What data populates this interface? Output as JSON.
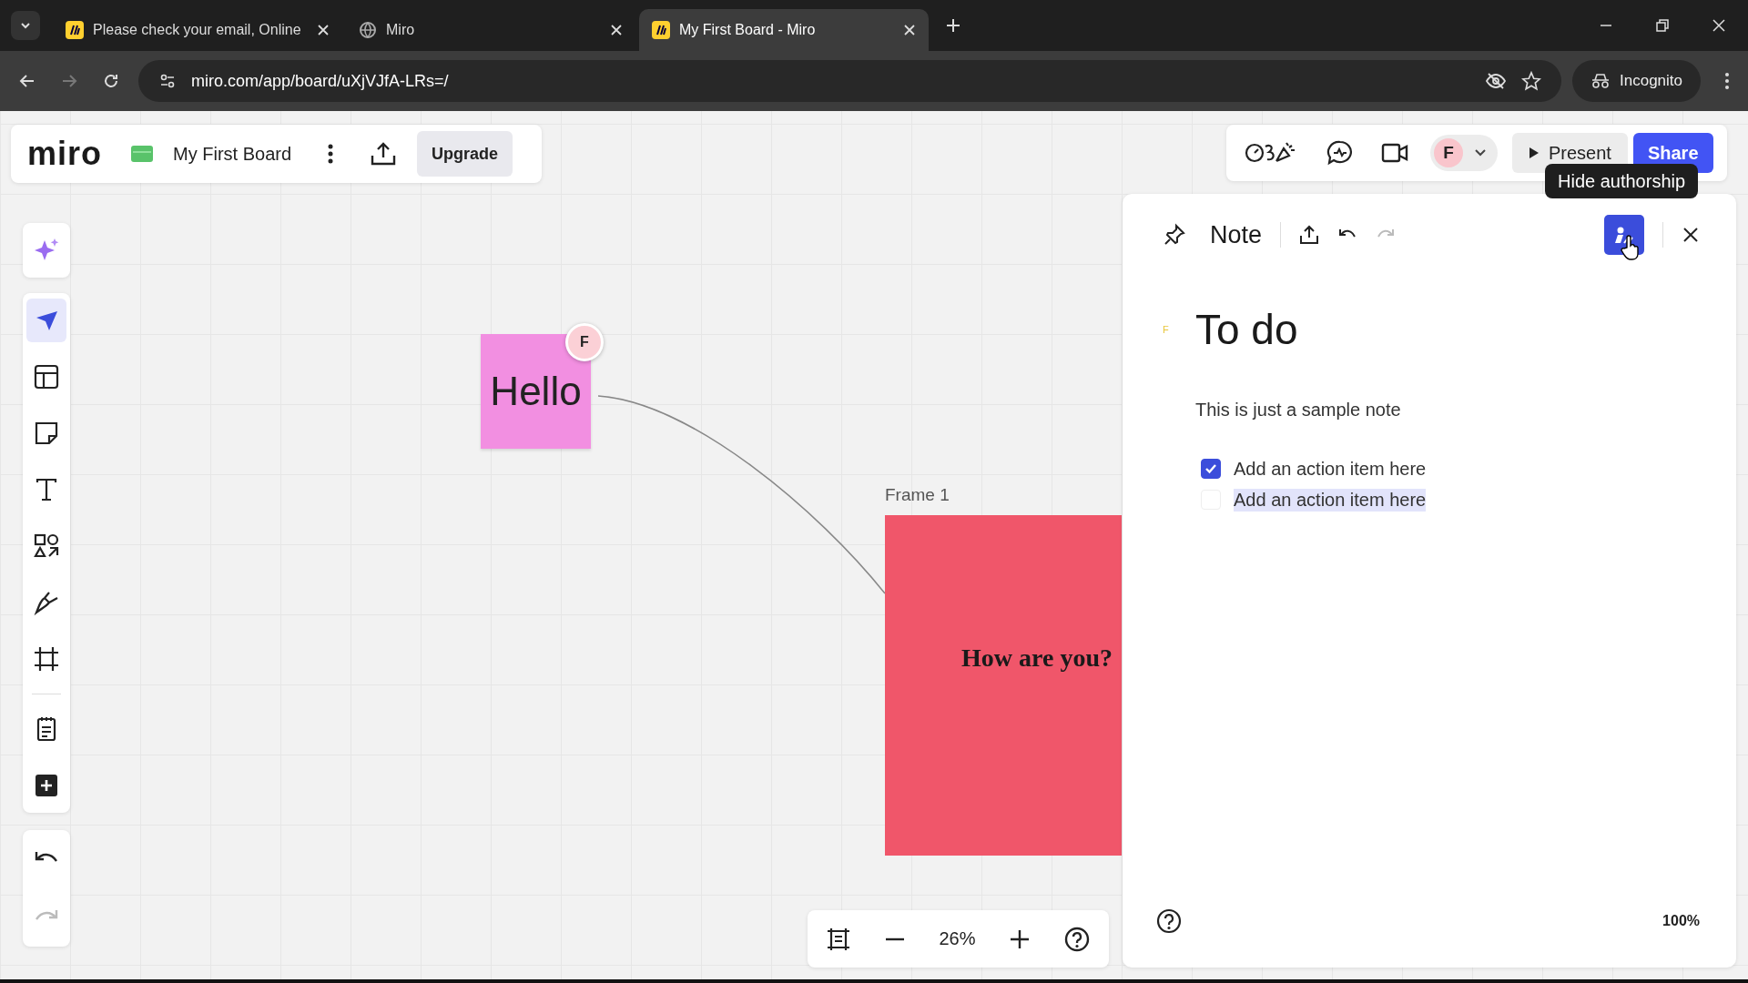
{
  "browser": {
    "tabs": [
      {
        "title": "Please check your email, Online",
        "kind": "miro",
        "selected": false
      },
      {
        "title": "Miro",
        "kind": "loading",
        "selected": false
      },
      {
        "title": "My First Board - Miro",
        "kind": "miro",
        "selected": true
      }
    ],
    "url": "miro.com/app/board/uXjVJfA-LRs=/",
    "incognito": "Incognito"
  },
  "board_header": {
    "logo": "miro",
    "board_name": "My First Board",
    "upgrade": "Upgrade"
  },
  "top_bar": {
    "avatar": "F",
    "present": "Present",
    "share": "Share",
    "tooltip": "Hide authorship"
  },
  "toolbar": {
    "tools": [
      {
        "kind": "select",
        "selected": true
      },
      {
        "kind": "templates",
        "selected": false
      },
      {
        "kind": "sticky",
        "selected": false
      },
      {
        "kind": "text",
        "selected": false
      },
      {
        "kind": "shapes",
        "selected": false
      },
      {
        "kind": "pen",
        "selected": false
      },
      {
        "kind": "frame",
        "selected": false
      }
    ],
    "extras": [
      {
        "kind": "notes",
        "selected": false
      },
      {
        "kind": "add",
        "selected": false
      }
    ]
  },
  "canvas": {
    "sticky_note": {
      "text": "Hello",
      "author": "F"
    },
    "frame": {
      "label": "Frame 1",
      "text": "How are you?"
    }
  },
  "note_panel": {
    "title": "Note",
    "authorship_on": true,
    "author": "F",
    "heading": "To do",
    "body": "This is just a sample note",
    "checklist": [
      {
        "text": "Add an action item here",
        "checked": true,
        "highlighted": false
      },
      {
        "text": "Add an action item here",
        "checked": false,
        "highlighted": true
      }
    ],
    "zoom": "100%"
  },
  "zoom_bar": {
    "zoom": "26%"
  }
}
